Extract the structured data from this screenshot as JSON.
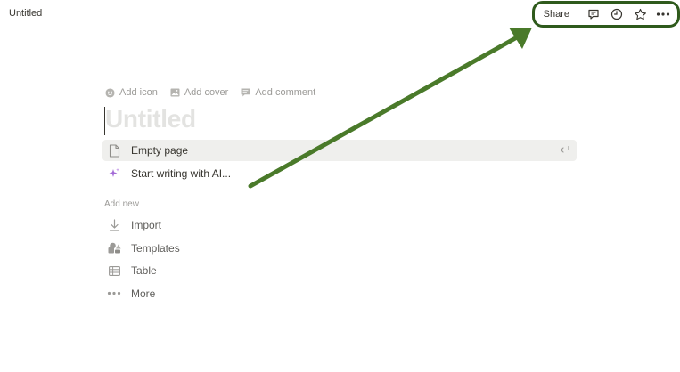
{
  "topbar": {
    "page_title": "Untitled",
    "share_label": "Share",
    "icons": [
      "comment-icon",
      "clock-icon",
      "star-icon",
      "more-icon"
    ]
  },
  "page": {
    "meta_actions": [
      {
        "label": "Add icon",
        "icon": "smiley-icon"
      },
      {
        "label": "Add cover",
        "icon": "image-icon"
      },
      {
        "label": "Add comment",
        "icon": "comment-icon"
      }
    ],
    "title_placeholder": "Untitled",
    "options": [
      {
        "label": "Empty page",
        "icon": "page-icon",
        "selected": true
      },
      {
        "label": "Start writing with AI...",
        "icon": "sparkle-icon",
        "selected": false
      }
    ],
    "add_new_label": "Add new",
    "add_new": [
      {
        "label": "Import",
        "icon": "download-icon"
      },
      {
        "label": "Templates",
        "icon": "templates-icon"
      },
      {
        "label": "Table",
        "icon": "table-icon"
      },
      {
        "label": "More",
        "icon": "more-icon"
      }
    ]
  },
  "colors": {
    "annotation": "#4a7a2a",
    "annotation_border": "#2f5a1c",
    "ai_accent": "#a36bd6"
  }
}
